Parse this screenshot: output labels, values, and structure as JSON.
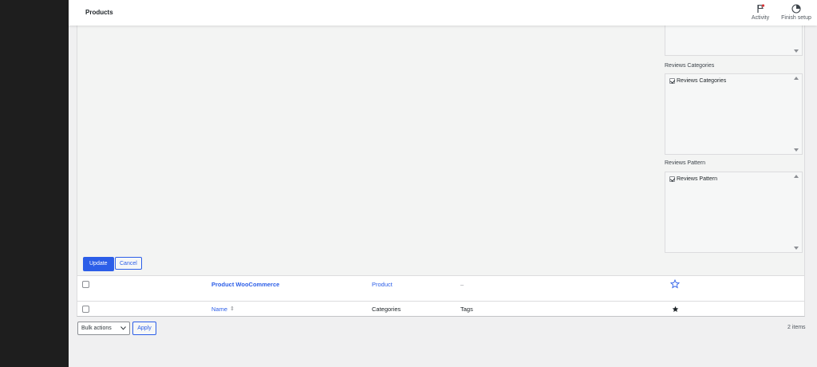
{
  "header": {
    "title": "Products",
    "activity_label": "Activity",
    "finish_setup_label": "Finish setup"
  },
  "quick_edit": {
    "taxonomies": [
      {
        "label": "Reviews Categories",
        "items": [
          {
            "label": "Reviews Categories",
            "checked": true
          }
        ]
      },
      {
        "label": "Reviews Pattern",
        "items": [
          {
            "label": "Reviews Pattern",
            "checked": true
          }
        ]
      }
    ],
    "update_label": "Update",
    "cancel_label": "Cancel"
  },
  "table": {
    "rows": [
      {
        "name": "Product WooCommerce",
        "categories": "Product",
        "tags": "–",
        "featured": false
      }
    ],
    "footer": {
      "name": "Name",
      "categories": "Categories",
      "tags": "Tags"
    }
  },
  "bulk_actions": {
    "selected": "Bulk actions",
    "apply_label": "Apply"
  },
  "item_count": "2 items",
  "colors": {
    "accent": "#2c5ee8",
    "sidebar": "#1e1e1e"
  }
}
